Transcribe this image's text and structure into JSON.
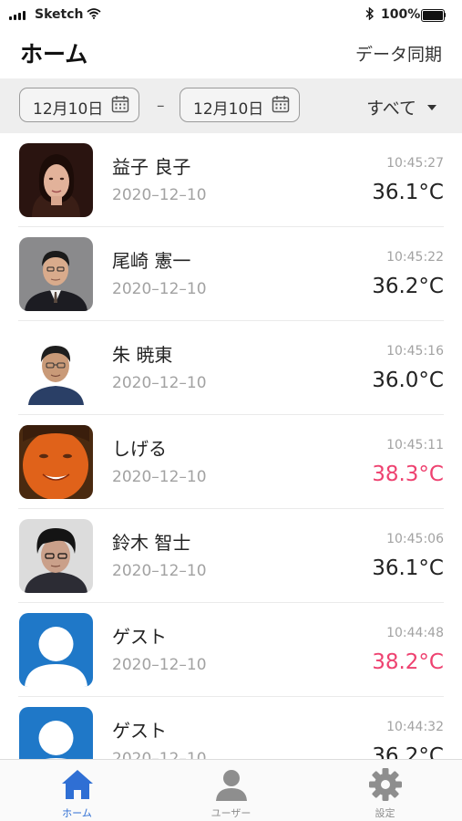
{
  "status_bar": {
    "carrier": "Sketch",
    "battery_percent": "100%",
    "battery_level": 1.0,
    "signal-icon": "signal-bars-icon",
    "wifi-icon": "wifi-icon",
    "bluetooth-icon": "bluetooth-icon"
  },
  "nav": {
    "title": "ホーム",
    "sync_label": "データ同期"
  },
  "filter": {
    "start_date": "12月10日",
    "end_date": "12月10日",
    "separator": "–",
    "category": "すべて",
    "calendar_icon": "calendar-icon",
    "caret_icon": "caret-down-icon"
  },
  "colors": {
    "accent": "#2f6fd4",
    "fever": "#ee4270",
    "normal_temp": "#222222",
    "secondary_text": "#a2a2a2",
    "guest_avatar": "#1f78c8"
  },
  "records": [
    {
      "name": "益子 良子",
      "date": "2020–12–10",
      "time": "10:45:27",
      "temperature": "36.1°C",
      "fever": false,
      "avatar": "photo"
    },
    {
      "name": "尾崎 憲一",
      "date": "2020–12–10",
      "time": "10:45:22",
      "temperature": "36.2°C",
      "fever": false,
      "avatar": "photo"
    },
    {
      "name": "朱 暁東",
      "date": "2020–12–10",
      "time": "10:45:16",
      "temperature": "36.0°C",
      "fever": false,
      "avatar": "photo"
    },
    {
      "name": "しげる",
      "date": "2020–12–10",
      "time": "10:45:11",
      "temperature": "38.3°C",
      "fever": true,
      "avatar": "photo"
    },
    {
      "name": "鈴木 智士",
      "date": "2020–12–10",
      "time": "10:45:06",
      "temperature": "36.1°C",
      "fever": false,
      "avatar": "photo"
    },
    {
      "name": "ゲスト",
      "date": "2020–12–10",
      "time": "10:44:48",
      "temperature": "38.2°C",
      "fever": true,
      "avatar": "guest-icon"
    },
    {
      "name": "ゲスト",
      "date": "2020–12–10",
      "time": "10:44:32",
      "temperature": "36.2°C",
      "fever": false,
      "avatar": "guest-icon"
    }
  ],
  "tabs": [
    {
      "label": "ホーム",
      "icon": "home-icon",
      "active": true
    },
    {
      "label": "ユーザー",
      "icon": "user-icon",
      "active": false
    },
    {
      "label": "設定",
      "icon": "gear-icon",
      "active": false
    }
  ]
}
